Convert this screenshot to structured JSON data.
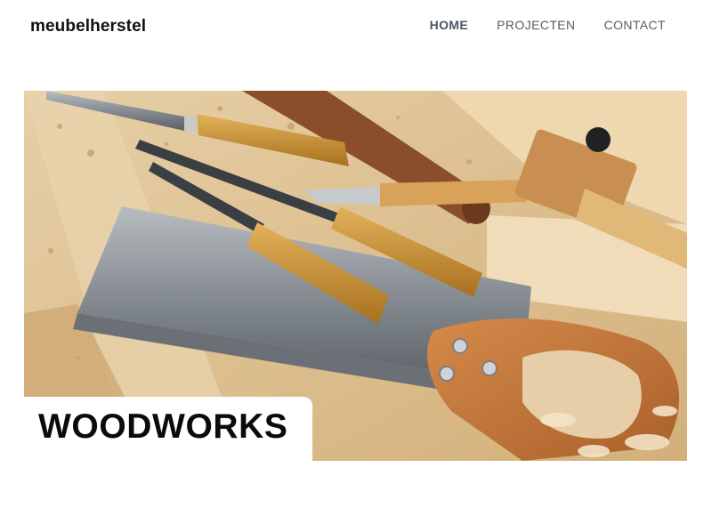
{
  "brand": {
    "logo_text": "meubelherstel"
  },
  "nav": {
    "items": [
      {
        "label": "HOME",
        "active": true
      },
      {
        "label": "PROJECTEN",
        "active": false
      },
      {
        "label": "CONTACT",
        "active": false
      }
    ]
  },
  "hero": {
    "image_subject": "woodworking-tools-photo",
    "title": "WOODWORKS"
  },
  "colors": {
    "text_dark": "#111111",
    "nav_text": "#555b66",
    "wood_light": "#e8cfa4",
    "wood_handle": "#c88f33",
    "saw_steel": "#8e949a"
  }
}
